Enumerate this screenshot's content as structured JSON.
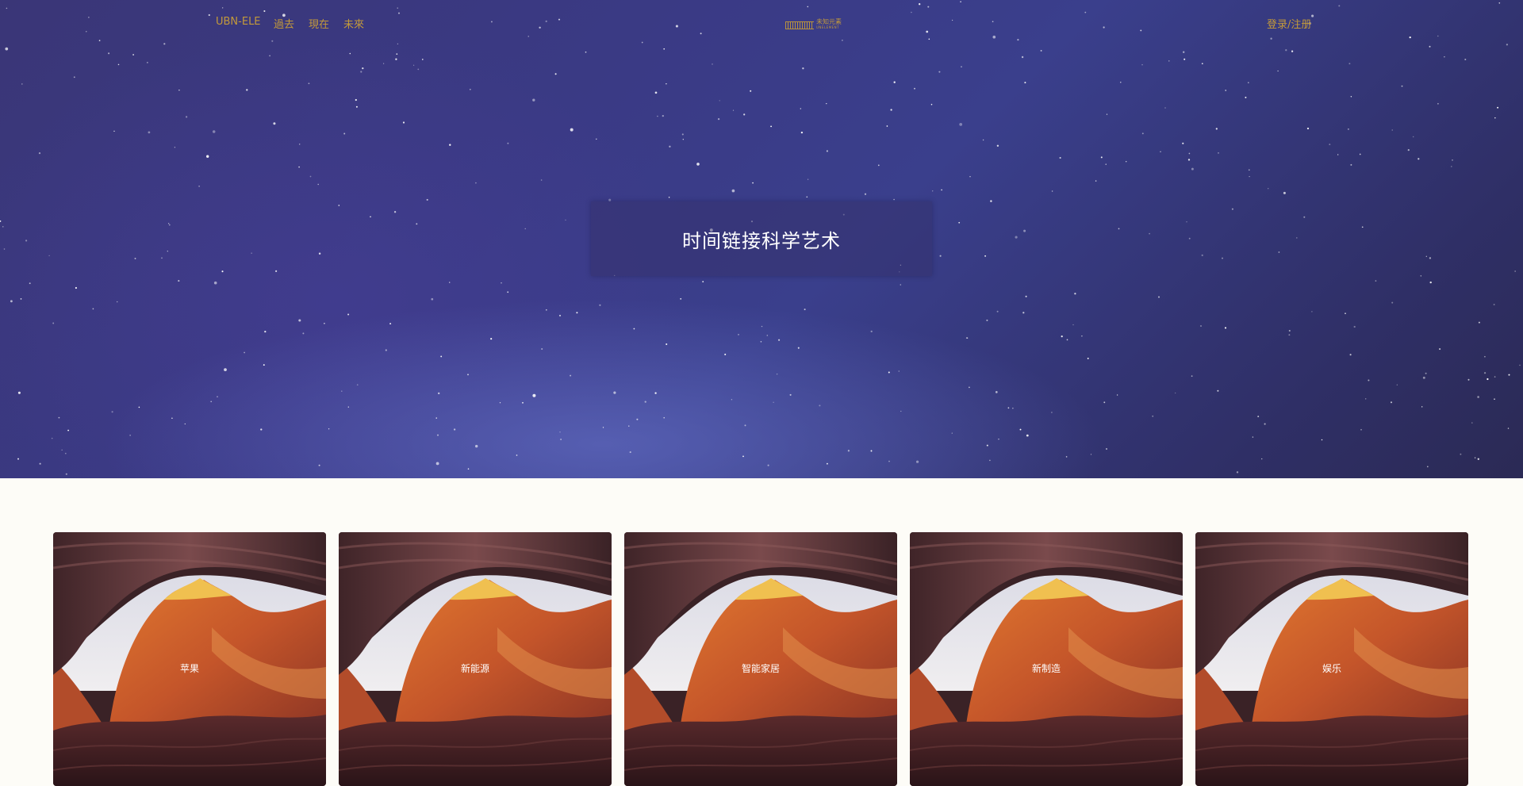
{
  "nav": {
    "brand": "UBN-ELE",
    "links": [
      "過去",
      "現在",
      "未來"
    ],
    "logo_cn": "未知元素",
    "logo_en": "UNELEMENT",
    "login": "登录/注册"
  },
  "hero": {
    "title": "时间链接科学艺术"
  },
  "cards": [
    {
      "label": "苹果"
    },
    {
      "label": "新能源"
    },
    {
      "label": "智能家居"
    },
    {
      "label": "新制造"
    },
    {
      "label": "娱乐"
    }
  ],
  "colors": {
    "accent": "#c49a3a",
    "hero_bg": "#3a3a85",
    "page_bg": "#fdfcf7"
  }
}
